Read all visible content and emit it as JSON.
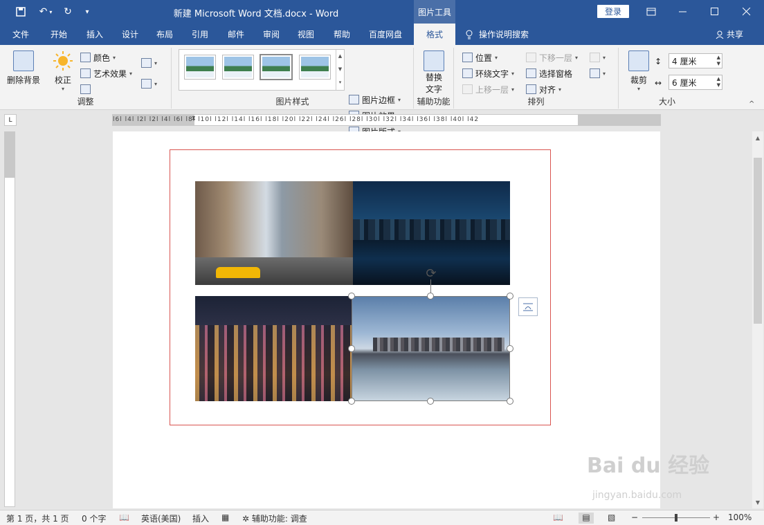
{
  "titlebar": {
    "title": "新建 Microsoft Word 文档.docx  -  Word",
    "context_label": "图片工具",
    "login": "登录",
    "undo_icon": "undo-icon",
    "redo_icon": "redo-icon"
  },
  "tabs": [
    {
      "label": "文件"
    },
    {
      "label": "开始"
    },
    {
      "label": "插入"
    },
    {
      "label": "设计"
    },
    {
      "label": "布局"
    },
    {
      "label": "引用"
    },
    {
      "label": "邮件"
    },
    {
      "label": "审阅"
    },
    {
      "label": "视图"
    },
    {
      "label": "帮助"
    },
    {
      "label": "百度网盘"
    },
    {
      "label": "格式"
    }
  ],
  "tell_me": "操作说明搜索",
  "share": "共享",
  "ribbon": {
    "adjust": {
      "remove_bg": "删除背景",
      "correct": "校正",
      "color": "颜色",
      "artistic": "艺术效果",
      "group_label": "调整"
    },
    "styles": {
      "border": "图片边框",
      "effects": "图片效果",
      "layout": "图片版式",
      "group_label": "图片样式"
    },
    "accessibility": {
      "alt_text_1": "替换",
      "alt_text_2": "文字",
      "group_label": "辅助功能"
    },
    "arrange": {
      "position": "位置",
      "wrap": "环绕文字",
      "forward": "上移一层",
      "backward": "下移一层",
      "selection_pane": "选择窗格",
      "align": "对齐",
      "group_label": "排列"
    },
    "size": {
      "crop": "裁剪",
      "height": "4 厘米",
      "width": "6 厘米",
      "group_label": "大小"
    }
  },
  "ruler": {
    "h_numbers": "l6l  l4l  l2l      l2l  l4l  l6l  l8l  l10l  l12l  l14l  l16l  l18l  l20l  l22l  l24l  l26l  l28l  l30l  l32l  l34l  l36l  l38l  l40l  l42"
  },
  "watermark": {
    "brand": "Bai du 经验",
    "url": "jingyan.baidu.com"
  },
  "status": {
    "page": "第 1 页，共 1 页",
    "words": "0 个字",
    "language": "英语(美国)",
    "mode": "插入",
    "accessibility": "辅助功能: 调查",
    "zoom": "100%"
  }
}
